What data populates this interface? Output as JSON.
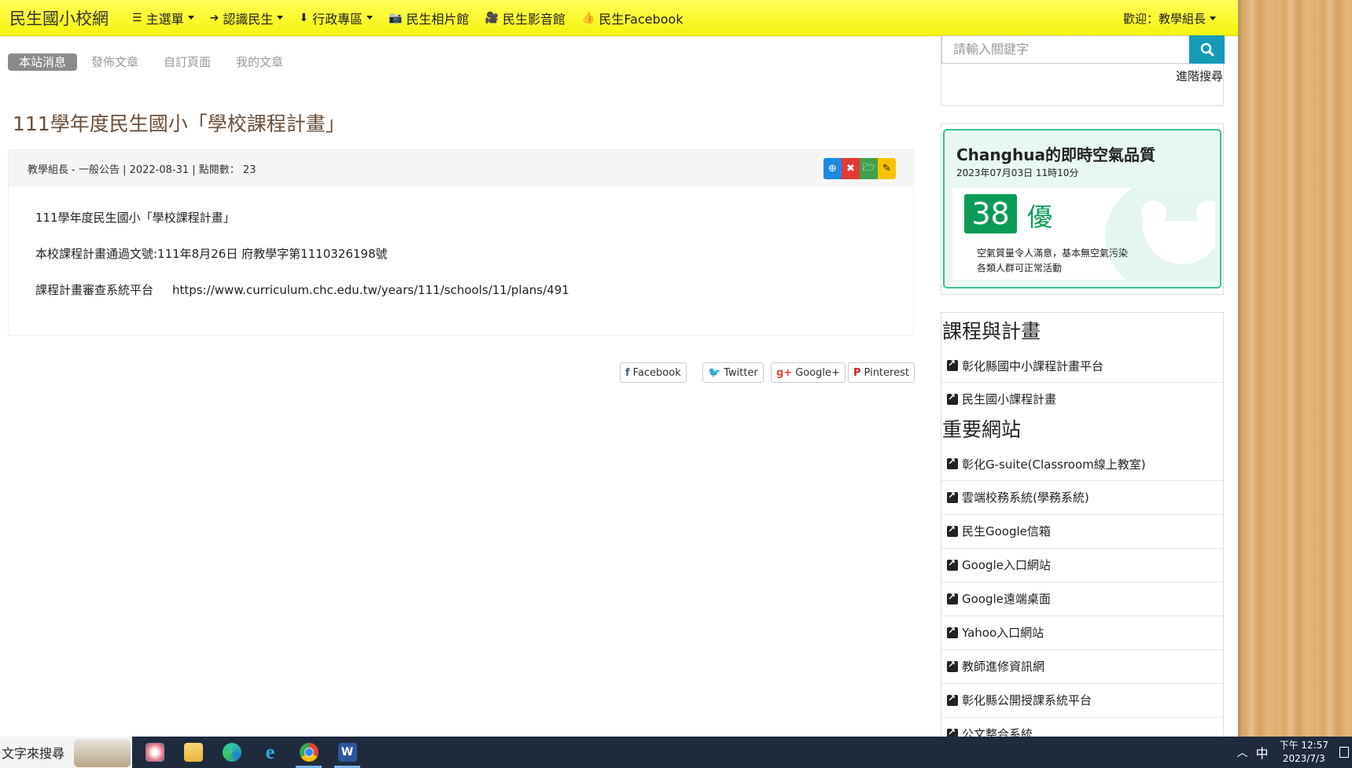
{
  "nav": {
    "brand": "民生國小校網",
    "items": [
      {
        "label": "主選單",
        "icon": "list-icon",
        "dropdown": true
      },
      {
        "label": "認識民生",
        "icon": "circle-arrow-right-icon",
        "dropdown": true
      },
      {
        "label": "行政專區",
        "icon": "circle-arrow-down-icon",
        "dropdown": true
      },
      {
        "label": "民生相片館",
        "icon": "camera-icon",
        "dropdown": false
      },
      {
        "label": "民生影音館",
        "icon": "video-camera-icon",
        "dropdown": false
      },
      {
        "label": "民生Facebook",
        "icon": "thumbs-up-icon",
        "dropdown": false
      }
    ],
    "welcome": "歡迎：教學組長"
  },
  "tabs": [
    "本站消息",
    "發佈文章",
    "自訂頁面",
    "我的文章"
  ],
  "article": {
    "title": "111學年度民生國小「學校課程計畫」",
    "meta": "教學組長 - 一般公告 | 2022-08-31 | 點閱數： 23",
    "line1": "111學年度民生國小「學校課程計畫」",
    "line2": "本校課程計畫通過文號:111年8月26日 府教學字第1110326198號",
    "line3_label": "課程計畫審查系統平台",
    "line3_link": "https://www.curriculum.chc.edu.tw/years/111/schools/11/plans/491"
  },
  "share": [
    "Facebook",
    "Twitter",
    "Google+",
    "Pinterest"
  ],
  "search": {
    "placeholder": "請輸入關鍵字",
    "advanced": "進階搜尋"
  },
  "air": {
    "title": "Changhua的即時空氣品質",
    "date": "2023年07月03日 11時10分",
    "aqi": "38",
    "level": "優",
    "desc1": "空氣質量令人滿意，基本無空氣污染",
    "desc2": "各類人群可正常活動",
    "accent": "#0a9b58"
  },
  "sections": [
    {
      "title": "課程與計畫",
      "links": [
        "彰化縣國中小課程計畫平台",
        "民生國小課程計畫"
      ]
    },
    {
      "title": "重要網站",
      "links": [
        "彰化G-suite(Classroom線上教室)",
        "雲端校務系統(學務系統)",
        "民生Google信箱",
        "Google入口網站",
        "Google遠端桌面",
        "Yahoo入口網站",
        "教師進修資訊網",
        "彰化縣公開授課系統平台",
        "公文整合系統"
      ]
    }
  ],
  "taskbar": {
    "search": "文字來搜尋",
    "ime": "中",
    "time": "下午 12:57",
    "date": "2023/7/3"
  }
}
